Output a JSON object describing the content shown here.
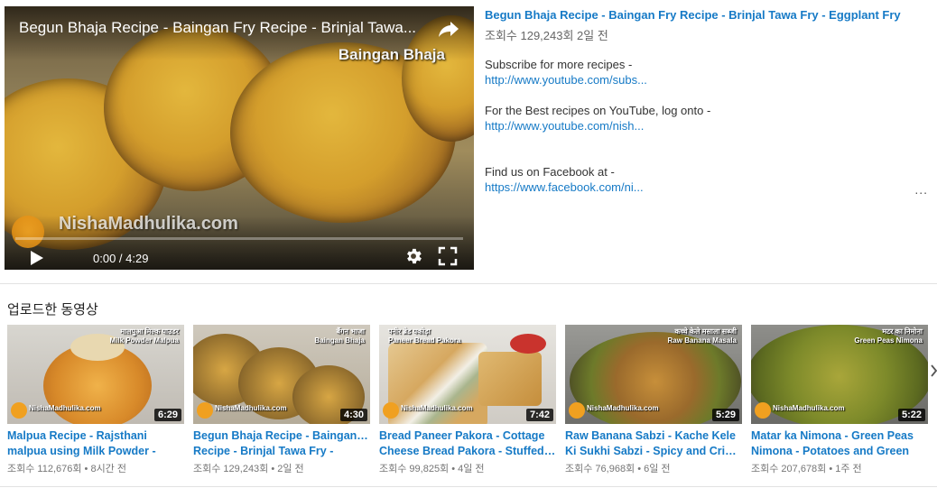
{
  "player": {
    "title": "Begun Bhaja Recipe - Baingan Fry Recipe - Brinjal Tawa...",
    "overlay_label": "Baingan Bhaja",
    "watermark": "NishaMadhulika.com",
    "time": "0:00 / 4:29",
    "progress": 0
  },
  "description": {
    "title": "Begun Bhaja Recipe - Baingan Fry Recipe - Brinjal Tawa Fry - Eggplant Fry",
    "meta": "조회수 129,243회  2일 전",
    "line1": "Subscribe for more recipes -",
    "link1": "http://www.youtube.com/subs...",
    "line2": "For the Best recipes on YouTube, log onto -",
    "link2": "http://www.youtube.com/nish...",
    "line3": "Find us on Facebook at -",
    "link3": "https://www.facebook.com/ni...",
    "more": "..."
  },
  "shelf": {
    "title": "업로드한 동영상",
    "videos": [
      {
        "title1": "Malpua Recipe - Rajsthani",
        "title2": "malpua using Milk Powder -",
        "meta": "조회수 112,676회 • 8시간 전",
        "duration": "6:29",
        "caption_top": "मालपुआ मिल्क पाउडर",
        "caption_sub": "Milk Powder Malpua",
        "watermark": "NishaMadhulika.com"
      },
      {
        "title1": "Begun Bhaja Recipe - Baingan Fry",
        "title2": "Recipe - Brinjal Tawa Fry -",
        "meta": "조회수 129,243회 • 2일 전",
        "duration": "4:30",
        "caption_top": "बैंगन भाजा",
        "caption_sub": "Baingan Bhaja",
        "watermark": "NishaMadhulika.com"
      },
      {
        "title1": "Bread Paneer Pakora - Cottage",
        "title2": "Cheese Bread Pakora - Stuffed ...",
        "meta": "조회수 99,825회 • 4일 전",
        "duration": "7:42",
        "caption_top": "पनीर ब्रेड पकोड़ा",
        "caption_sub": "Paneer Bread Pakora",
        "watermark": "NishaMadhulika.com"
      },
      {
        "title1": "Raw Banana Sabzi - Kache Kele",
        "title2": "Ki Sukhi Sabzi - Spicy and Crisp...",
        "meta": "조회수 76,968회 • 6일 전",
        "duration": "5:29",
        "caption_top": "कच्चे केले मसाला सब्जी",
        "caption_sub": "Raw Banana Masala",
        "watermark": "NishaMadhulika.com"
      },
      {
        "title1": "Matar ka Nimona - Green Peas",
        "title2": "Nimona - Potatoes and Green",
        "meta": "조회수 207,678회 • 1주 전",
        "duration": "5:22",
        "caption_top": "मटर का निमोना",
        "caption_sub": "Green Peas Nimona",
        "watermark": "NishaMadhulika.com"
      }
    ]
  },
  "colors": {
    "link": "#167ac6",
    "meta": "#767676"
  }
}
